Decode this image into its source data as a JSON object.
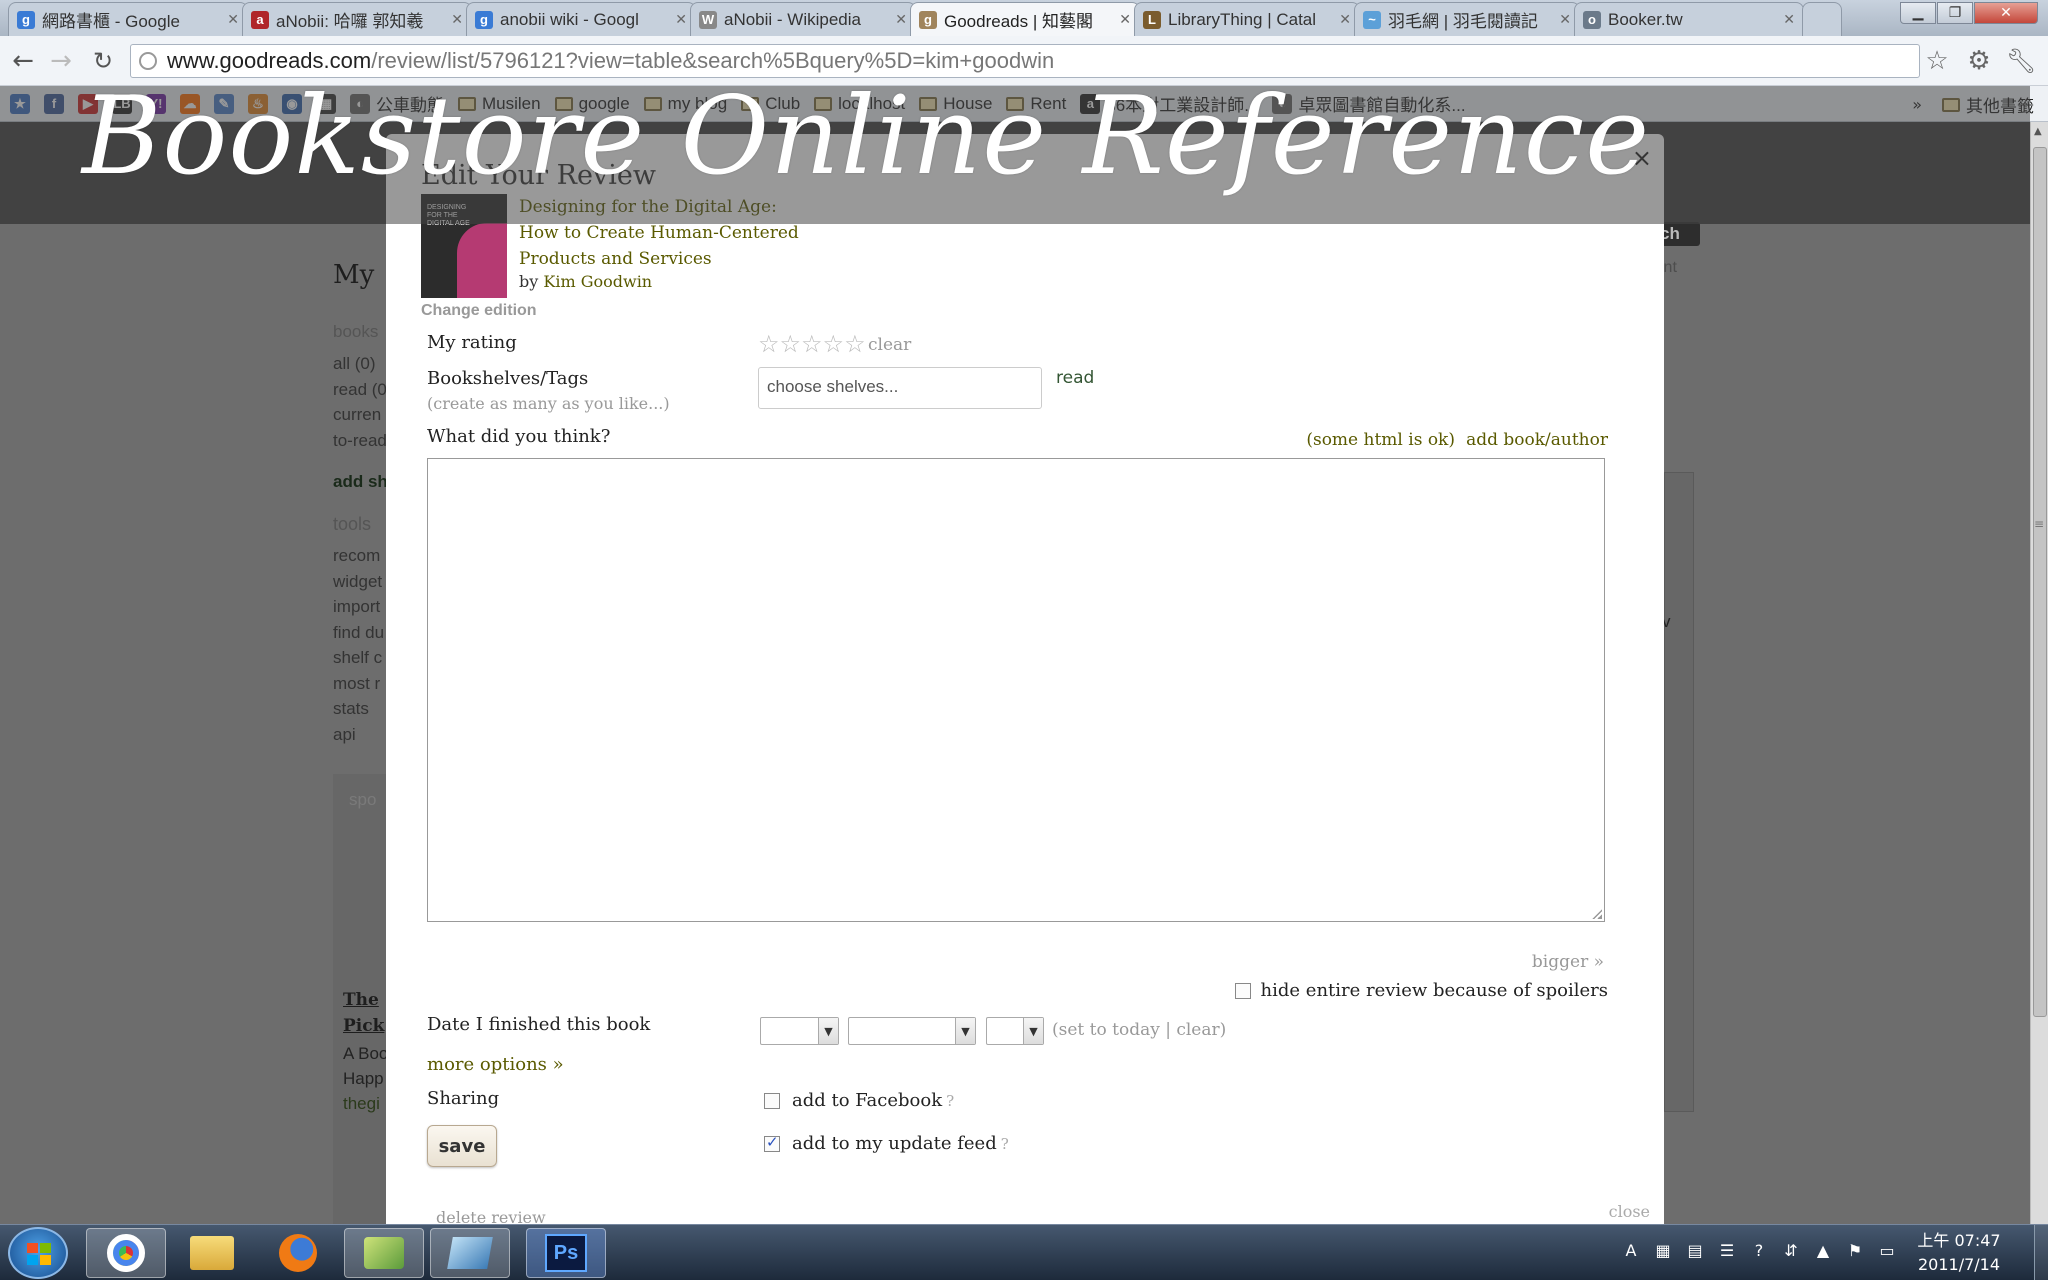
{
  "browser": {
    "tabs": [
      {
        "label": "網路書櫃 - Google",
        "fav_color": "#3a7bd5",
        "fav": "g"
      },
      {
        "label": "aNobii: 哈囉 郭知羲",
        "fav_color": "#b0262a",
        "fav": "a"
      },
      {
        "label": "anobii wiki - Googl",
        "fav_color": "#3a7bd5",
        "fav": "g"
      },
      {
        "label": "aNobii - Wikipedia",
        "fav_color": "#888888",
        "fav": "W"
      },
      {
        "label": "Goodreads | 知藝閣",
        "fav_color": "#a0845c",
        "fav": "g"
      },
      {
        "label": "LibraryThing | Catal",
        "fav_color": "#7a5c2e",
        "fav": "L"
      },
      {
        "label": "羽毛網 | 羽毛閱讀記",
        "fav_color": "#5ca0d8",
        "fav": "~"
      },
      {
        "label": "Booker.tw",
        "fav_color": "#6b7a8a",
        "fav": "o"
      }
    ],
    "active_tab": 4,
    "url_host": "www.goodreads.com",
    "url_rest": "/review/list/5796121?view=table&search%5Bquery%5D=kim+goodwin",
    "bookmarks": [
      {
        "label": "",
        "icon": "star-bookmark-icon",
        "color": "#3a6fc2",
        "glyph": "★"
      },
      {
        "label": "",
        "icon": "facebook-icon",
        "color": "#3b5998",
        "glyph": "f"
      },
      {
        "label": "",
        "icon": "youtube-icon",
        "color": "#cc2020",
        "glyph": "▶"
      },
      {
        "label": "",
        "icon": "lb-icon",
        "color": "#222222",
        "glyph": "LB"
      },
      {
        "label": "",
        "icon": "yahoo-icon",
        "color": "#6b1fa0",
        "glyph": "Y!"
      },
      {
        "label": "",
        "icon": "soundcloud-icon",
        "color": "#ff6a00",
        "glyph": "☁"
      },
      {
        "label": "",
        "icon": "feather-icon",
        "color": "#4a7cc8",
        "glyph": "✎"
      },
      {
        "label": "",
        "icon": "flame-icon",
        "color": "#e08020",
        "glyph": "♨"
      },
      {
        "label": "",
        "icon": "globe-icon",
        "color": "#2a5ea8",
        "glyph": "◉"
      },
      {
        "label": "",
        "icon": "qr-icon",
        "color": "#333333",
        "glyph": "▦"
      },
      {
        "label": "公車動態",
        "icon": "globe-icon",
        "color": "#666666",
        "glyph": "◐"
      },
      {
        "label": "Musilen",
        "icon": "folder-icon"
      },
      {
        "label": "google",
        "icon": "folder-icon"
      },
      {
        "label": "my blog",
        "icon": "folder-icon"
      },
      {
        "label": "Club",
        "icon": "folder-icon"
      },
      {
        "label": "localhost",
        "icon": "folder-icon"
      },
      {
        "label": "House",
        "icon": "folder-icon"
      },
      {
        "label": "Rent",
        "icon": "folder-icon"
      },
      {
        "label": "36本對工業設計師...",
        "icon": "amazon-icon",
        "color": "#222222",
        "glyph": "a"
      },
      {
        "label": "卓眾圖書館自動化系...",
        "icon": "globe-icon",
        "color": "#666666",
        "glyph": "◐"
      }
    ],
    "other_bookmarks": "其他書籤"
  },
  "watermark": "Bookstore Online Reference",
  "background_page": {
    "heading": "My",
    "search_btn": "ch",
    "print": "int",
    "sidebar_title": "books",
    "shelves": [
      "all (0)",
      "read (0)",
      "curren",
      "to-read"
    ],
    "add_shelf": "add sh",
    "tools_title": "tools",
    "tools": [
      "recom",
      "widget",
      "import",
      "find du",
      "shelf c",
      "most r",
      "stats",
      "api"
    ],
    "spoiler_box": "spo",
    "promo_title_1": "The",
    "promo_title_2": "Pick",
    "promo_line_1": "A Boo",
    "promo_line_2": "Happ",
    "promo_link": "thegi",
    "right_letter": "v"
  },
  "modal": {
    "title": "Edit Your Review",
    "close_glyph": "×",
    "book_title": "Designing for the Digital Age: How to Create Human-Centered Products and Services",
    "cover_text": "DESIGNING FOR THE DIGITAL AGE",
    "by": "by",
    "author": "Kim Goodwin",
    "change_edition": "Change edition",
    "rating_label": "My rating",
    "rating_value": 0,
    "rating_max": 5,
    "rating_clear": "clear",
    "shelves_label": "Bookshelves/Tags",
    "shelves_hint": "(create as many as you like...)",
    "shelves_placeholder": "choose shelves...",
    "shelves_read": "read",
    "review_label": "What did you think?",
    "html_ok": "(some html is ok)",
    "add_book_author": "add book/author",
    "review_text": "",
    "bigger": "bigger »",
    "spoiler_label": "hide entire review because of spoilers",
    "date_label": "Date I finished this book",
    "set_today": "(set to today | clear)",
    "more_options": "more options »",
    "sharing_label": "Sharing",
    "facebook_label": "add to Facebook",
    "facebook_checked": false,
    "feed_label": "add to my update feed",
    "feed_checked": true,
    "help": "?",
    "save": "save",
    "delete_review": "delete review",
    "close": "close"
  },
  "taskbar": {
    "time": "上午 07:47",
    "date": "2011/7/14"
  }
}
